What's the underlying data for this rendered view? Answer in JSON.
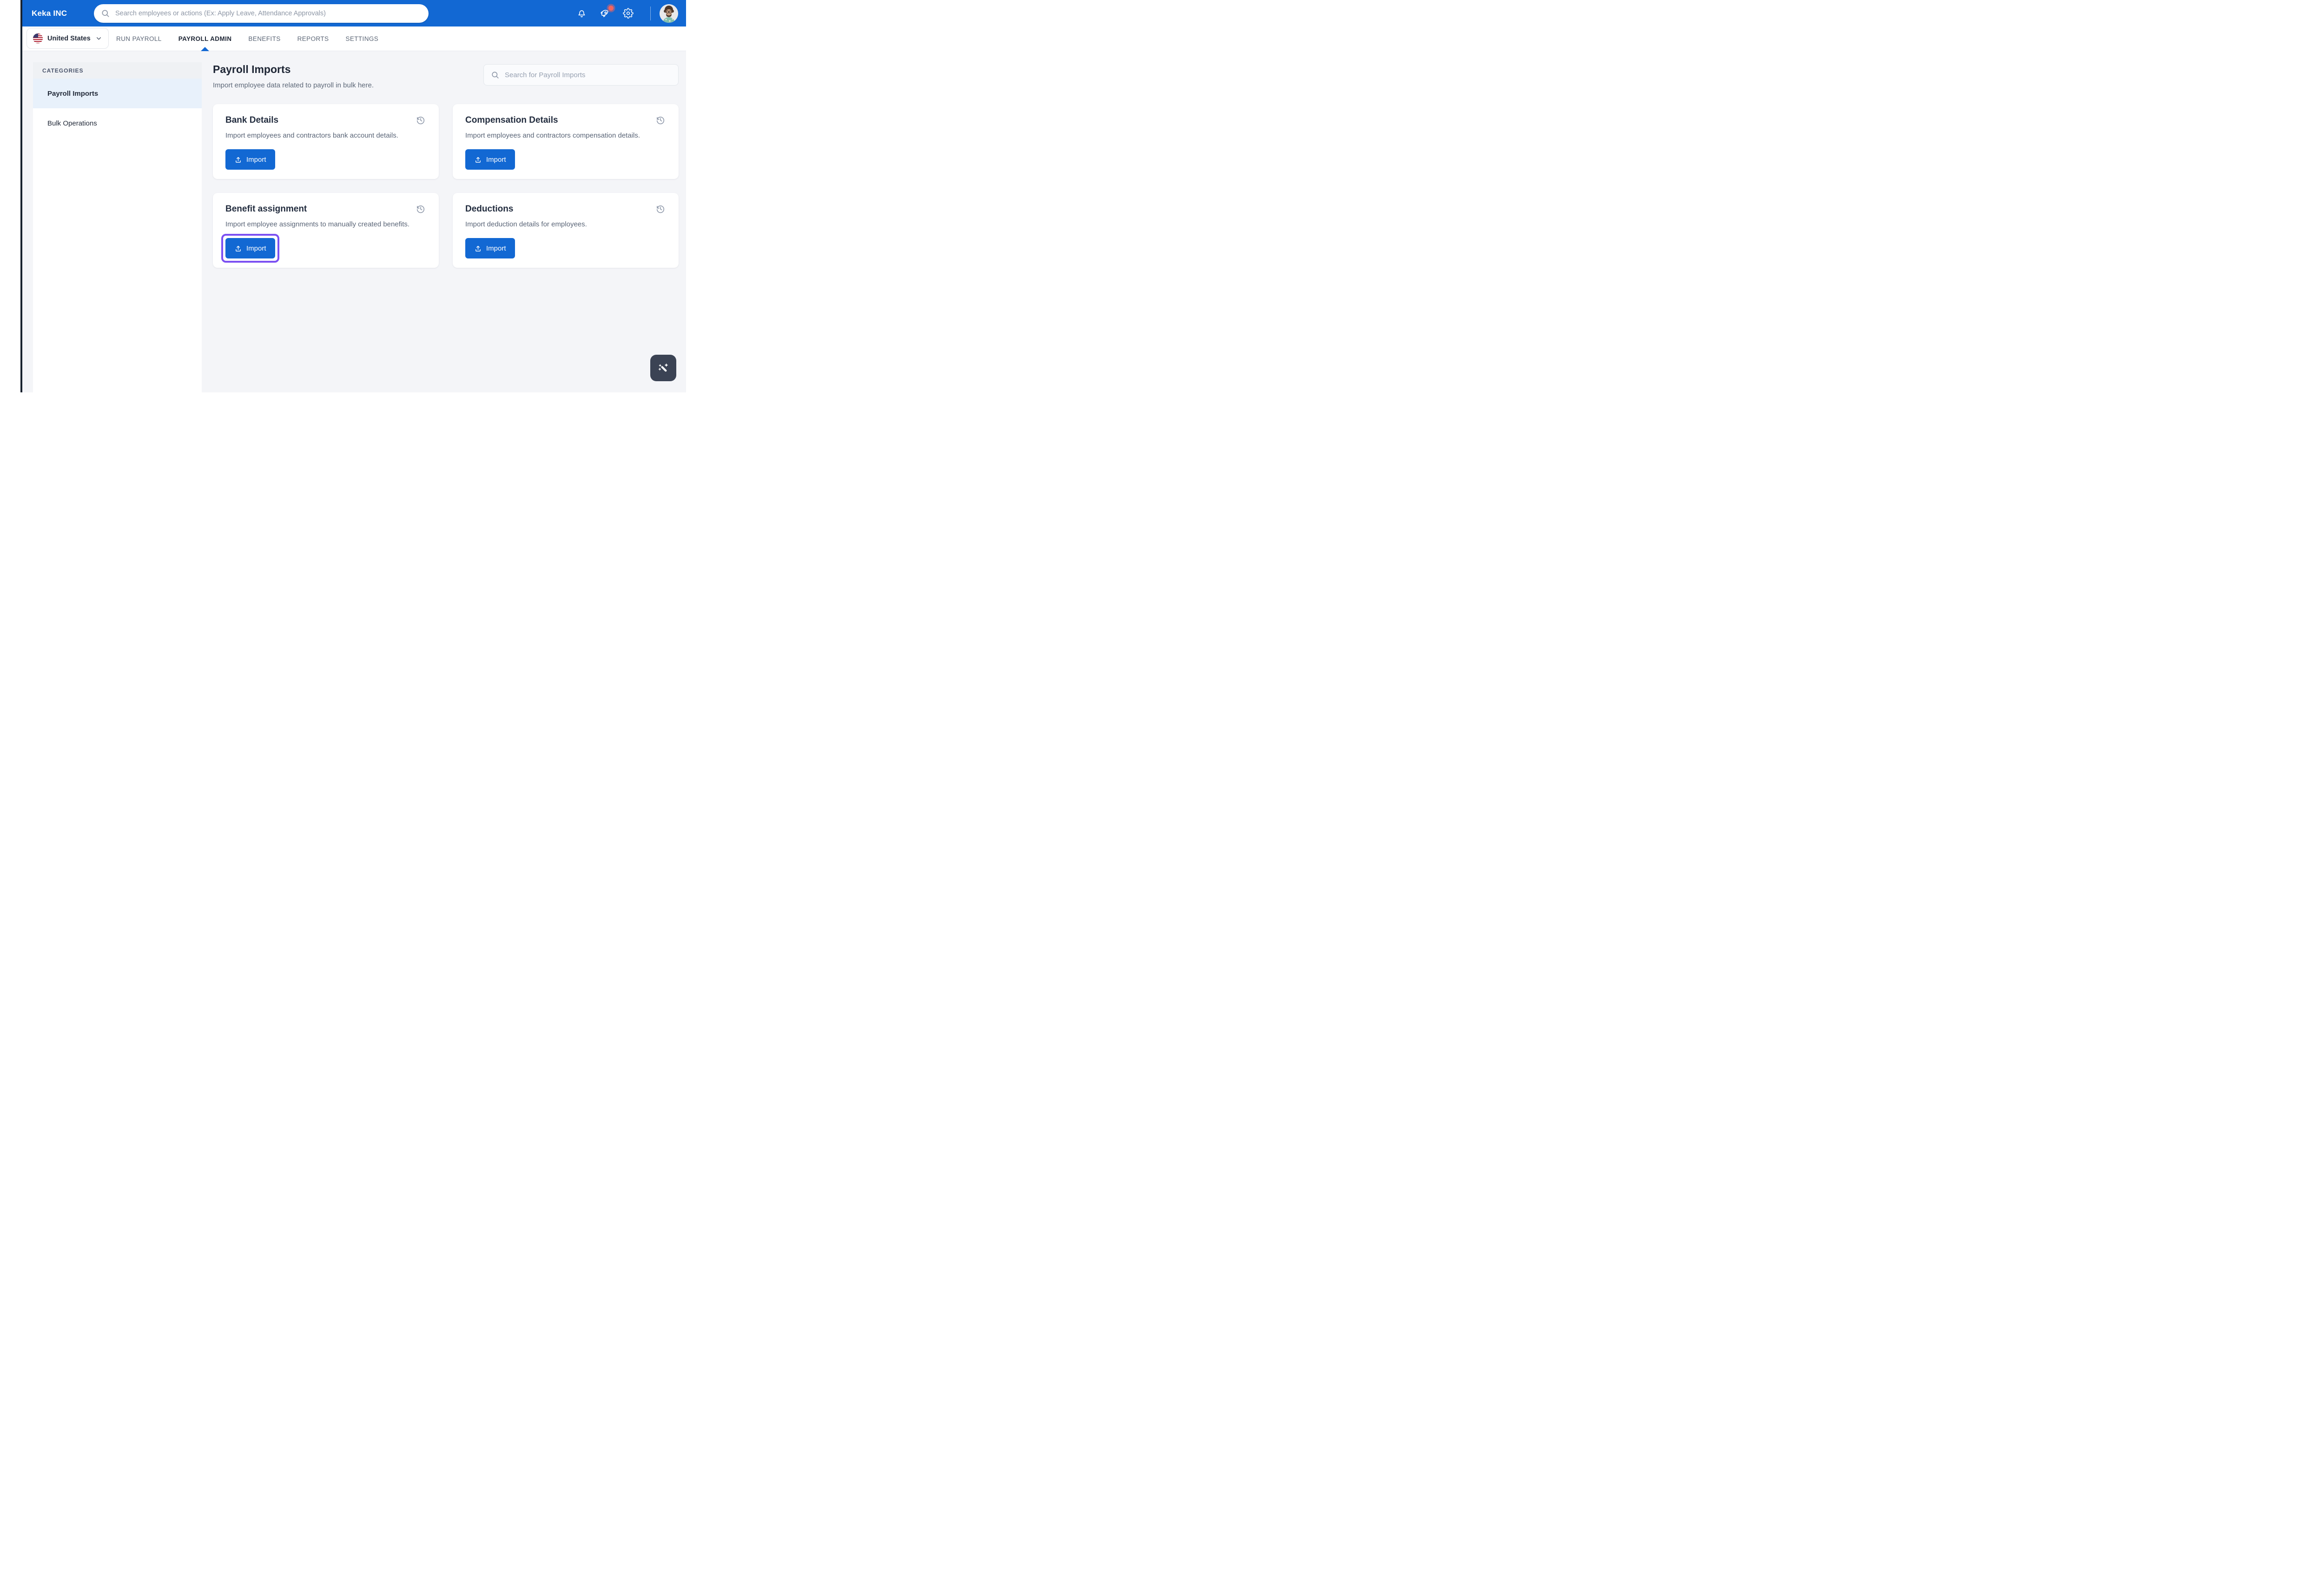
{
  "header": {
    "brand": "Keka INC",
    "search": {
      "placeholder": "Search employees or actions (Ex: Apply Leave, Attendance Approvals)"
    },
    "action_icons": [
      "bell-icon",
      "rocket-icon",
      "gear-icon"
    ],
    "avatar": "user-avatar-photo"
  },
  "nav": {
    "region_selector": {
      "label": "United States",
      "flag": "us-flag"
    },
    "tabs": [
      {
        "label": "RUN PAYROLL",
        "active": false
      },
      {
        "label": "PAYROLL ADMIN",
        "active": true
      },
      {
        "label": "BENEFITS",
        "active": false
      },
      {
        "label": "REPORTS",
        "active": false
      },
      {
        "label": "SETTINGS",
        "active": false
      }
    ]
  },
  "sidebar": {
    "heading": "CATEGORIES",
    "items": [
      {
        "label": "Payroll Imports",
        "selected": true
      },
      {
        "label": "Bulk Operations",
        "selected": false
      }
    ]
  },
  "main": {
    "title": "Payroll Imports",
    "subtitle": "Import employee data related to payroll in bulk here.",
    "search": {
      "placeholder": "Search for Payroll Imports"
    },
    "cards": [
      {
        "title": "Bank Details",
        "description": "Import employees and contractors bank account details.",
        "button_label": "Import",
        "icon": "history-icon",
        "highlighted": false
      },
      {
        "title": "Compensation Details",
        "description": "Import employees and contractors compensation details.",
        "button_label": "Import",
        "icon": "history-icon",
        "highlighted": false
      },
      {
        "title": "Benefit assignment",
        "description": "Import employee assignments to manually created benefits.",
        "button_label": "Import",
        "icon": "history-icon",
        "highlighted": true
      },
      {
        "title": "Deductions",
        "description": "Import deduction details for employees.",
        "button_label": "Import",
        "icon": "history-icon",
        "highlighted": false
      }
    ],
    "fab": {
      "icon": "magic-wand-icon"
    }
  },
  "colors": {
    "header_blue": "#1268d3",
    "button_blue": "#1268d3",
    "highlight_purple": "#7b50f2",
    "badge_red": "#f4645f",
    "fab_dark": "#3b4354",
    "selected_item_bg": "#e8f1fb",
    "body_bg": "#f4f5f8"
  }
}
